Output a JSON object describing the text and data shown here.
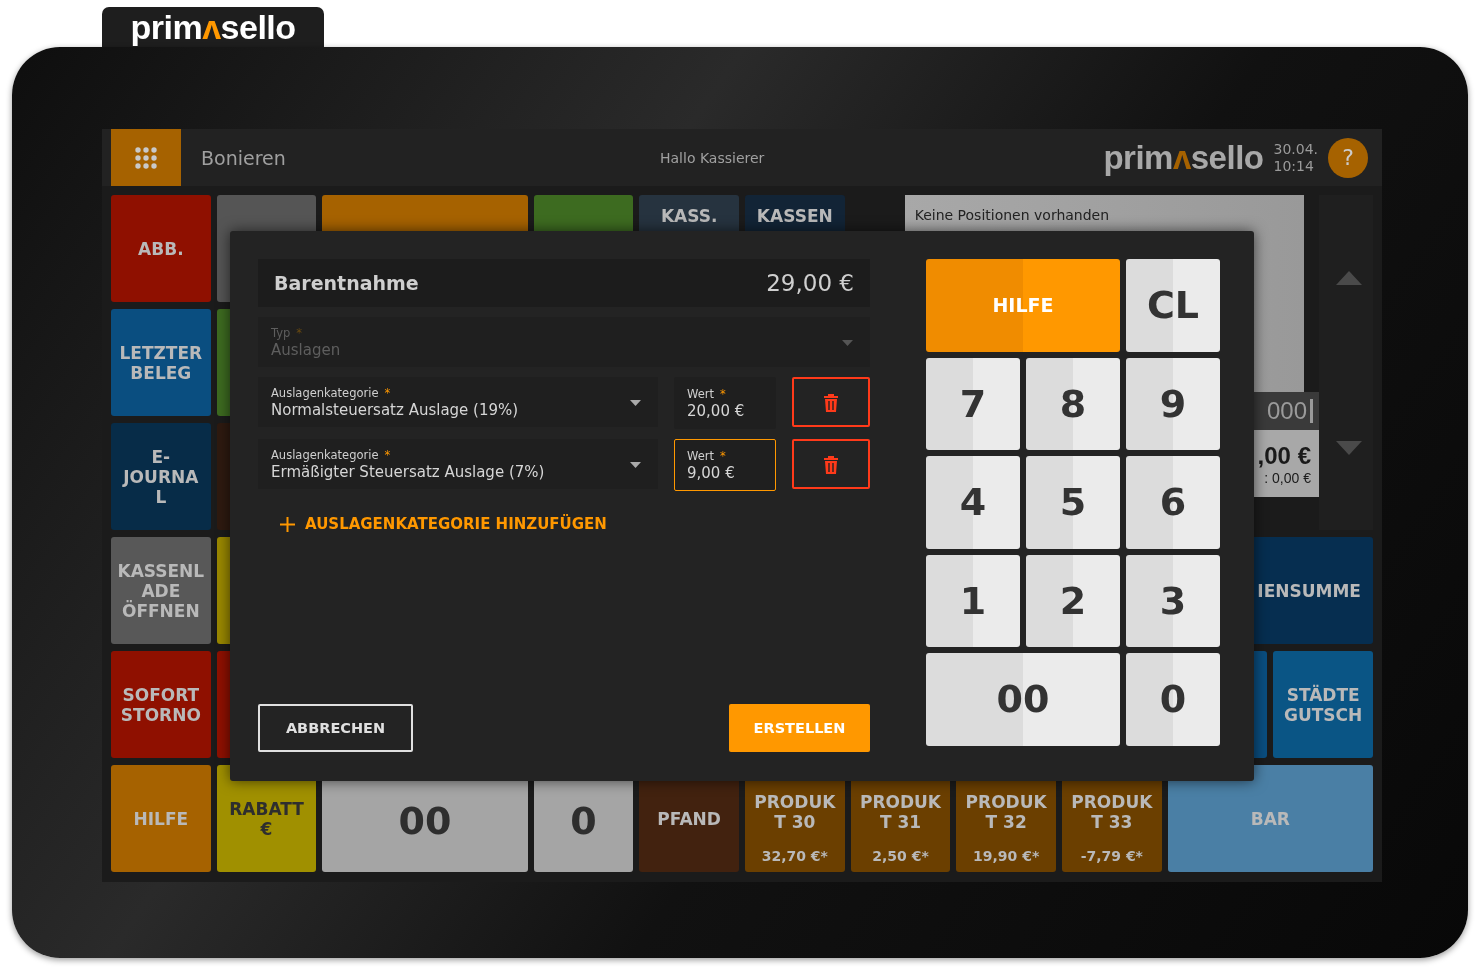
{
  "brand_tab": {
    "logo": {
      "before": "prim",
      "accent": "ʌ",
      "after": "sello"
    }
  },
  "header": {
    "title": "Bonieren",
    "greeting": "Hallo Kassierer",
    "logo": {
      "before": "prim",
      "accent": "ʌ",
      "after": "sello"
    },
    "date": "30.04.",
    "time": "10:14",
    "help": "?"
  },
  "tile_rows": [
    [
      {
        "kind": "function",
        "label": "ABB.",
        "color": "#8f1000"
      },
      {
        "kind": "function",
        "color": "#555555"
      },
      {
        "kind": "function",
        "color": "#a66200",
        "wide": true
      },
      {
        "kind": "function",
        "color": "#3d6b20"
      },
      {
        "kind": "function",
        "label": "KASS.",
        "color": "#26333f"
      },
      {
        "kind": "function",
        "label": "KASSEN",
        "color": "#122436"
      }
    ],
    [
      {
        "kind": "function",
        "label": "LETZTER\nBELEG",
        "color": "#0a4e80"
      },
      {
        "kind": "function",
        "color": "#3d6b20"
      }
    ],
    [
      {
        "kind": "function",
        "label": "E-\nJOURNA\nL",
        "color": "#072c48"
      },
      {
        "kind": "function",
        "color": "#2e1a10"
      }
    ],
    [
      {
        "kind": "function",
        "label": "KASSENL\nADE\nÖFFNEN",
        "color": "#585858"
      },
      {
        "kind": "function",
        "color": "#9a8800"
      },
      {
        "kind": "function",
        "label": "IENSUMME",
        "color": "#062e50",
        "wide": true
      }
    ],
    [
      {
        "kind": "function",
        "label": "SOFORT\nSTORNO",
        "color": "#8f1000"
      },
      {
        "kind": "function",
        "color": "#8f1000"
      },
      {
        "kind": "function",
        "color": "#0a4e80"
      },
      {
        "kind": "function",
        "label": "STÄDTE\nGUTSCH",
        "color": "#0a5585"
      }
    ],
    [
      {
        "kind": "function",
        "label": "HILFE",
        "color": "#a66200"
      },
      {
        "kind": "discount",
        "label": "RABATT\n€",
        "color": "#a09000"
      },
      {
        "kind": "digit",
        "label": "00",
        "color": "#a5a5a5",
        "wide": true
      },
      {
        "kind": "digit",
        "label": "0",
        "color": "#a5a5a5"
      },
      {
        "kind": "function",
        "label": "PFAND",
        "color": "#42220f"
      },
      {
        "kind": "product",
        "label": "PRODUK\nT 30",
        "price": "32,70 €*",
        "color": "#6b3f00"
      },
      {
        "kind": "product",
        "label": "PRODUK\nT 31",
        "price": "2,50 €*",
        "color": "#6b3f00"
      },
      {
        "kind": "product",
        "label": "PRODUK\nT 32",
        "price": "19,90 €*",
        "color": "#6b3f00"
      },
      {
        "kind": "product",
        "label": "PRODUK\nT 33",
        "price": "-7,79 €*",
        "color": "#6b3f00"
      },
      {
        "kind": "function",
        "label": "BAR",
        "color": "#4a7fa5",
        "wide": true
      }
    ]
  ],
  "receipt": {
    "empty_text": "Keine Positionen vorhanden",
    "entry": "000",
    "total": ",00 €",
    "subtotal": ": 0,00 €"
  },
  "dialog": {
    "title": "Barentnahme",
    "amount": "29,00 €",
    "type_field": {
      "label": "Typ",
      "required_mark": "*",
      "value": "Auslagen",
      "disabled": true
    },
    "categories": [
      {
        "label": "Auslagenkategorie",
        "required_mark": "*",
        "value": "Normalsteuersatz Auslage (19%)",
        "amount": {
          "label": "Wert",
          "required_mark": "*",
          "value": "20,00 €",
          "focused": false
        }
      },
      {
        "label": "Auslagenkategorie",
        "required_mark": "*",
        "value": "Ermäßigter Steuersatz Auslage (7%)",
        "amount": {
          "label": "Wert",
          "required_mark": "*",
          "value": "9,00 €",
          "focused": true
        }
      }
    ],
    "add_label": "AUSLAGENKATEGORIE HINZUFÜGEN",
    "cancel": "ABBRECHEN",
    "create": "ERSTELLEN",
    "keypad": [
      {
        "kind": "help",
        "label": "HILFE",
        "wide": true
      },
      {
        "kind": "digit",
        "label": "CL"
      },
      {
        "kind": "digit",
        "label": "7"
      },
      {
        "kind": "digit",
        "label": "8"
      },
      {
        "kind": "digit",
        "label": "9"
      },
      {
        "kind": "digit",
        "label": "4"
      },
      {
        "kind": "digit",
        "label": "5"
      },
      {
        "kind": "digit",
        "label": "6"
      },
      {
        "kind": "digit",
        "label": "1"
      },
      {
        "kind": "digit",
        "label": "2"
      },
      {
        "kind": "digit",
        "label": "3"
      },
      {
        "kind": "digit",
        "label": "00",
        "wide": true
      },
      {
        "kind": "digit",
        "label": "0"
      }
    ]
  }
}
